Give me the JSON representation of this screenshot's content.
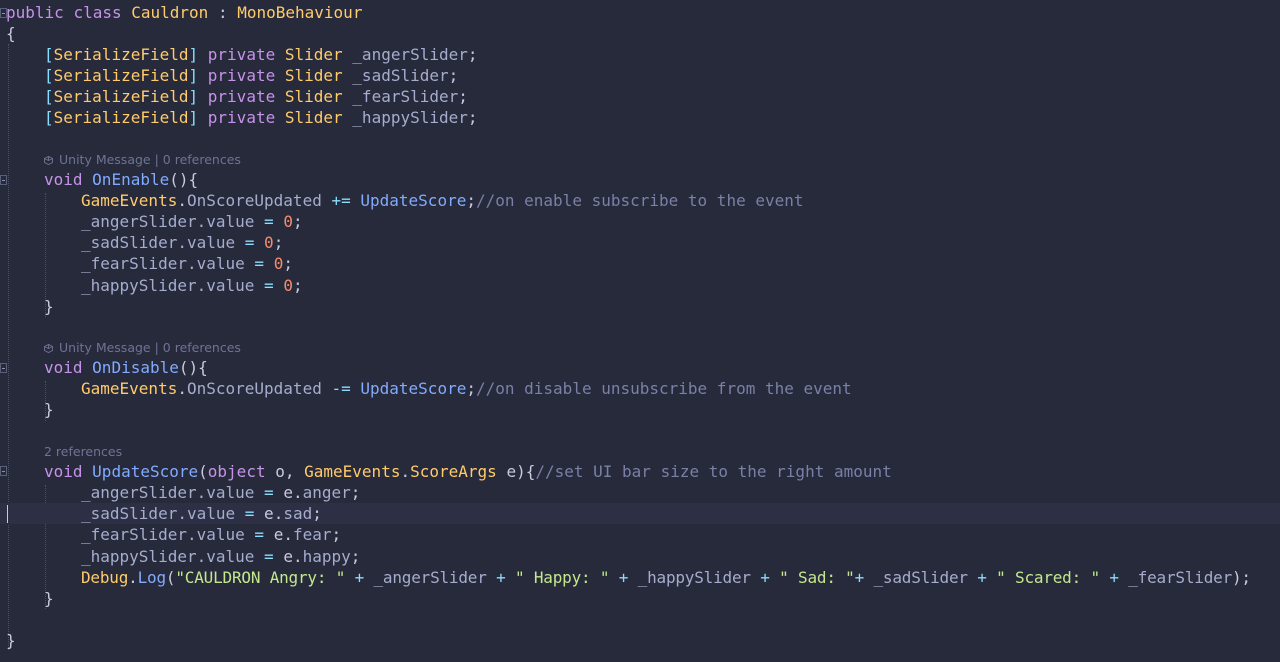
{
  "editor": {
    "class_decl": {
      "kw1": "public",
      "kw2": "class",
      "name": "Cauldron",
      "sep": " : ",
      "base": "MonoBehaviour"
    },
    "open_brace": "{",
    "close_brace": "}",
    "fields": [
      {
        "attr": "SerializeField",
        "mod": "private",
        "type": "Slider",
        "name": "_angerSlider"
      },
      {
        "attr": "SerializeField",
        "mod": "private",
        "type": "Slider",
        "name": "_sadSlider"
      },
      {
        "attr": "SerializeField",
        "mod": "private",
        "type": "Slider",
        "name": "_fearSlider"
      },
      {
        "attr": "SerializeField",
        "mod": "private",
        "type": "Slider",
        "name": "_happySlider"
      }
    ],
    "lens_unity": {
      "label": "Unity Message",
      "sep": " | ",
      "refs": "0 references"
    },
    "lens_two": "2 references",
    "on_enable": {
      "void": "void",
      "name": "OnEnable",
      "parens": "(){",
      "event_class": "GameEvents",
      "event_member": "OnScoreUpdated",
      "op": "+=",
      "handler": "UpdateScore",
      "comment": "//on enable subscribe to the event",
      "resets": [
        {
          "target": "_angerSlider.value",
          "value": "0"
        },
        {
          "target": "_sadSlider.value",
          "value": "0"
        },
        {
          "target": "_fearSlider.value",
          "value": "0"
        },
        {
          "target": "_happySlider.value",
          "value": "0"
        }
      ]
    },
    "on_disable": {
      "void": "void",
      "name": "OnDisable",
      "parens": "(){",
      "event_class": "GameEvents",
      "event_member": "OnScoreUpdated",
      "op": "-=",
      "handler": "UpdateScore",
      "comment": "//on disable unsubscribe from the event"
    },
    "update_score": {
      "void": "void",
      "name": "UpdateScore",
      "kw_object": "object",
      "p1": "o",
      "t2a": "GameEvents",
      "t2b": "ScoreArgs",
      "p2": "e",
      "comment": "//set UI bar size to the right amount",
      "assigns": [
        {
          "target": "_angerSlider.value",
          "member": "anger"
        },
        {
          "target": "_sadSlider.value",
          "member": "sad"
        },
        {
          "target": "_fearSlider.value",
          "member": "fear"
        },
        {
          "target": "_happySlider.value",
          "member": "happy"
        }
      ],
      "log": {
        "cls": "Debug",
        "fn": "Log",
        "s1": "\"CAULDRON Angry: \"",
        "v1": "_angerSlider",
        "s2": "\" Happy: \"",
        "v2": "_happySlider",
        "s3": "\" Sad: \"",
        "v3": "_sadSlider",
        "s4": "\" Scared: \"",
        "v4": "_fearSlider"
      }
    }
  }
}
